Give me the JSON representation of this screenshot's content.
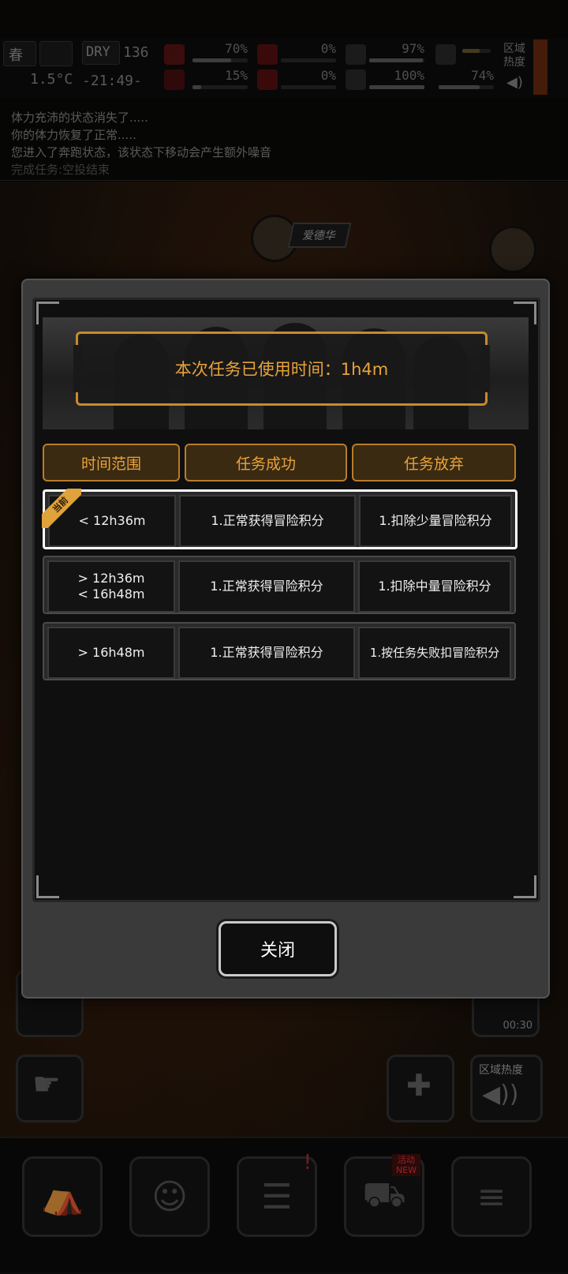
{
  "status": {
    "season": "春",
    "weather_tag": "DRY",
    "day": "136",
    "temperature": "1.5°C",
    "clock": "-21:49-",
    "stats": [
      "70%",
      "0%",
      "97%",
      "15%",
      "0%",
      "100%",
      "74%"
    ],
    "region_heat_label": "区域热度"
  },
  "log": {
    "lines": [
      "体力充沛的状态消失了.....",
      "你的体力恢复了正常.....",
      "您进入了奔跑状态，该状态下移动会产生额外噪音",
      "完成任务:空投结束"
    ]
  },
  "scene": {
    "npc_name": "爱德华",
    "timer": "00:30",
    "region_heat_button": "区域热度"
  },
  "modal": {
    "elapsed_text": "本次任务已使用时间：1h4m",
    "headers": {
      "range": "时间范围",
      "success": "任务成功",
      "abandon": "任务放弃"
    },
    "current_badge": "当前",
    "rows": [
      {
        "range": "< 12h36m",
        "success": "1.正常获得冒险积分",
        "abandon": "1.扣除少量冒险积分",
        "current": true
      },
      {
        "range": "> 12h36m\n< 16h48m",
        "success": "1.正常获得冒险积分",
        "abandon": "1.扣除中量冒险积分",
        "current": false
      },
      {
        "range": "> 16h48m",
        "success": "1.正常获得冒险积分",
        "abandon": "1.按任务失败扣冒险积分",
        "current": false
      }
    ],
    "close_label": "关闭"
  },
  "nav": {
    "shop_badge": "活动 NEW"
  },
  "colors": {
    "accent": "#e8a33a",
    "header_bg": "#3a2a12",
    "panel_bg": "#0f0f0f"
  }
}
